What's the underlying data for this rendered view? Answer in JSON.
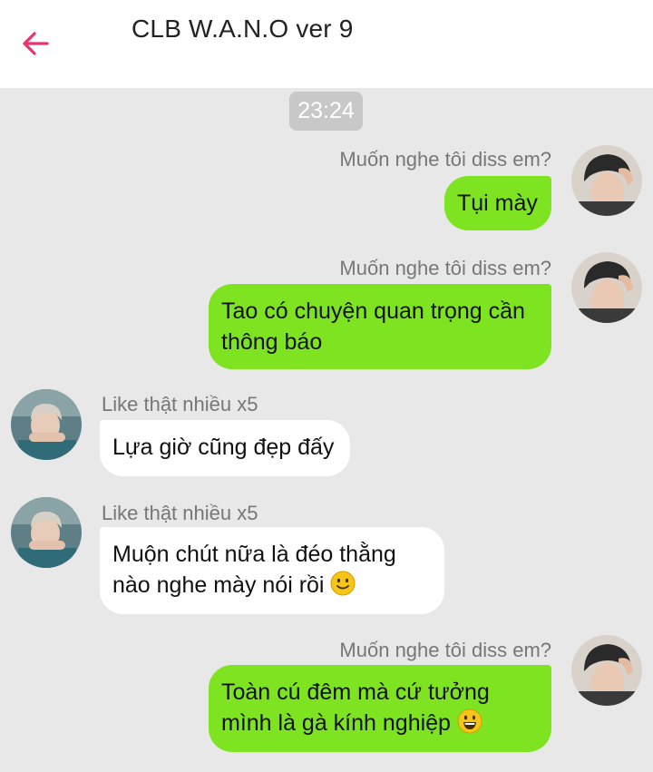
{
  "header": {
    "title": "CLB W.A.N.O ver 9",
    "back_icon": "arrow-left-icon",
    "accent_color": "#e8336f"
  },
  "chat": {
    "timestamp": "23:24",
    "messages": [
      {
        "direction": "outgoing",
        "sender": "Muốn nghe tôi diss em?",
        "lines": [
          "Tụi mày"
        ],
        "emoji": ""
      },
      {
        "direction": "outgoing",
        "sender": "Muốn nghe tôi diss em?",
        "lines": [
          "Tao có chuyện quan trọng cần",
          "thông báo"
        ],
        "emoji": ""
      },
      {
        "direction": "incoming",
        "sender": "Like thật nhiều x5",
        "lines": [
          "Lựa giờ cũng đẹp đấy"
        ],
        "emoji": ""
      },
      {
        "direction": "incoming",
        "sender": "Like thật nhiều x5",
        "lines": [
          "Muộn chút nữa là đéo thằng",
          "nào nghe mày nói rồi"
        ],
        "emoji": "slightly-smiling-face"
      },
      {
        "direction": "outgoing",
        "sender": "Muốn nghe tôi diss em?",
        "lines": [
          "Toàn cú đêm mà cứ tưởng",
          "mình là gà kính nghiệp"
        ],
        "emoji": "grinning-face"
      }
    ]
  },
  "colors": {
    "outgoing_bubble": "#7ee320",
    "incoming_bubble": "#ffffff",
    "background": "#e8e8e8"
  }
}
